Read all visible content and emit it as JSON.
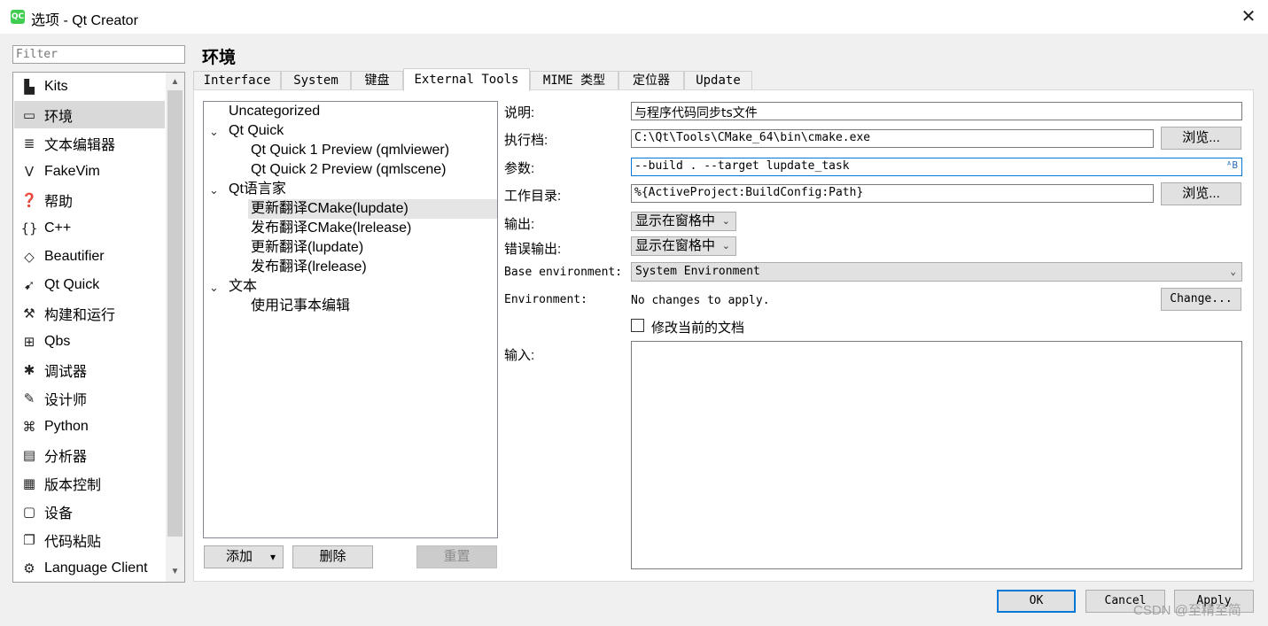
{
  "window": {
    "title": "选项 - Qt Creator",
    "app_icon": "QC",
    "close": "✕"
  },
  "filter": {
    "placeholder": "Filter"
  },
  "sidebar": {
    "items": [
      {
        "label": "Kits",
        "icon": "kits-icon",
        "glyph": "▙"
      },
      {
        "label": "环境",
        "icon": "monitor-icon",
        "glyph": "▭"
      },
      {
        "label": "文本编辑器",
        "icon": "text-editor-icon",
        "glyph": "≣"
      },
      {
        "label": "FakeVim",
        "icon": "fakevim-icon",
        "glyph": "V"
      },
      {
        "label": "帮助",
        "icon": "help-icon",
        "glyph": "❓"
      },
      {
        "label": "C++",
        "icon": "cpp-icon",
        "glyph": "{}"
      },
      {
        "label": "Beautifier",
        "icon": "diamond-icon",
        "glyph": "◇"
      },
      {
        "label": "Qt Quick",
        "icon": "qt-quick-icon",
        "glyph": "➹"
      },
      {
        "label": "构建和运行",
        "icon": "hammer-icon",
        "glyph": "⚒"
      },
      {
        "label": "Qbs",
        "icon": "qbs-icon",
        "glyph": "⊞"
      },
      {
        "label": "调试器",
        "icon": "bug-icon",
        "glyph": "✱"
      },
      {
        "label": "设计师",
        "icon": "pencil-icon",
        "glyph": "✎"
      },
      {
        "label": "Python",
        "icon": "python-icon",
        "glyph": "⌘"
      },
      {
        "label": "分析器",
        "icon": "analyzer-icon",
        "glyph": "▤"
      },
      {
        "label": "版本控制",
        "icon": "version-control-icon",
        "glyph": "▦"
      },
      {
        "label": "设备",
        "icon": "device-icon",
        "glyph": "▢"
      },
      {
        "label": "代码粘贴",
        "icon": "paste-icon",
        "glyph": "❐"
      },
      {
        "label": "Language Client",
        "icon": "language-client-icon",
        "glyph": "⚙"
      }
    ],
    "selected": "环境"
  },
  "page": {
    "title": "环境"
  },
  "tabs": [
    {
      "label": "Interface"
    },
    {
      "label": "System"
    },
    {
      "label": "键盘"
    },
    {
      "label": "External Tools"
    },
    {
      "label": "MIME 类型"
    },
    {
      "label": "定位器"
    },
    {
      "label": "Update"
    }
  ],
  "active_tab": "External Tools",
  "tree": {
    "rows": [
      {
        "label": "Uncategorized"
      },
      {
        "label": "Qt Quick"
      },
      {
        "label": "Qt Quick 1 Preview (qmlviewer)"
      },
      {
        "label": "Qt Quick 2 Preview (qmlscene)"
      },
      {
        "label": "Qt语言家"
      },
      {
        "label": "更新翻译CMake(lupdate)"
      },
      {
        "label": "发布翻译CMake(lrelease)"
      },
      {
        "label": "更新翻译(lupdate)"
      },
      {
        "label": "发布翻译(lrelease)"
      },
      {
        "label": "文本"
      },
      {
        "label": "使用记事本编辑"
      }
    ],
    "selected": "更新翻译CMake(lupdate)"
  },
  "tree_buttons": {
    "add": "添加",
    "add_arrow": "▾",
    "remove": "删除",
    "reset": "重置"
  },
  "form": {
    "description_label": "说明:",
    "description_value": "与程序代码同步ts文件",
    "executable_label": "执行档:",
    "executable_value": "C:\\Qt\\Tools\\CMake_64\\bin\\cmake.exe",
    "browse": "浏览...",
    "arguments_label": "参数:",
    "arguments_value": "--build . --target lupdate_task",
    "workdir_label": "工作目录:",
    "workdir_value": "%{ActiveProject:BuildConfig:Path}",
    "output_label": "输出:",
    "output_value": "显示在窗格中",
    "error_label": "错误输出:",
    "error_value": "显示在窗格中",
    "base_env_label": "Base environment:",
    "base_env_value": "System Environment",
    "env_label": "Environment:",
    "env_value": "No changes to apply.",
    "change": "Change...",
    "modify_doc_label": "修改当前的文档",
    "input_label": "输入:"
  },
  "dialog_buttons": {
    "ok": "OK",
    "cancel": "Cancel",
    "apply": "Apply"
  },
  "watermark": "CSDN @至精至简"
}
